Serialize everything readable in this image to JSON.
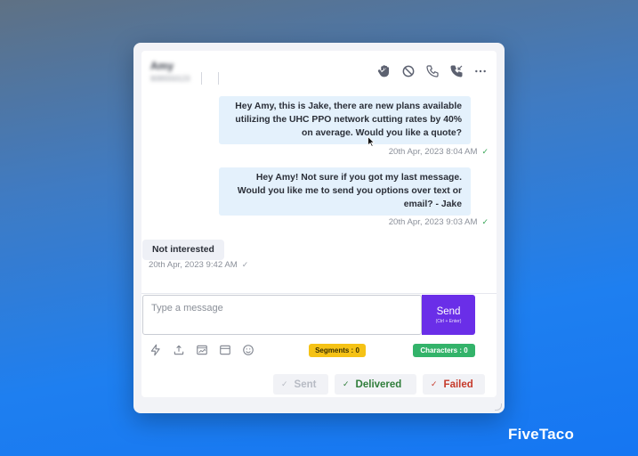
{
  "contact": {
    "name": "Amy",
    "phone": "9095550123"
  },
  "header_icons": [
    "hand-stop-icon",
    "block-icon",
    "phone-icon",
    "phone-callback-icon",
    "more-icon"
  ],
  "messages": [
    {
      "direction": "outgoing",
      "text": "Hey Amy, this is Jake, there are new plans available utilizing the UHC PPO network cutting rates by 40% on average. Would you like a quote?",
      "timestamp": "20th Apr, 2023 8:04 AM",
      "status": "delivered"
    },
    {
      "direction": "outgoing",
      "text": "Hey Amy! Not sure if you got my last message. Would you like me to send you options over text or email? - Jake",
      "timestamp": "20th Apr, 2023 9:03 AM",
      "status": "delivered"
    },
    {
      "direction": "incoming",
      "text": "Not interested",
      "timestamp": "20th Apr, 2023 9:42 AM",
      "status": "sent"
    }
  ],
  "composer": {
    "placeholder": "Type a message",
    "value": "",
    "send_label": "Send",
    "send_hint": "(Ctrl + Enter)"
  },
  "toolbar_icons": [
    "lightning-icon",
    "upload-icon",
    "image-icon",
    "calendar-icon",
    "emoji-icon"
  ],
  "counters": {
    "segments": "Segments : 0",
    "characters": "Characters : 0"
  },
  "status_filters": {
    "sent": "Sent",
    "delivered": "Delivered",
    "failed": "Failed"
  },
  "colors": {
    "send_button": "#6a2ee8",
    "segments_badge": "#f5c215",
    "characters_badge": "#33b36a",
    "delivered": "#2f7d3a",
    "failed": "#c63a2b",
    "outgoing_bubble": "#e4f1fc"
  },
  "brand": "FiveTaco"
}
